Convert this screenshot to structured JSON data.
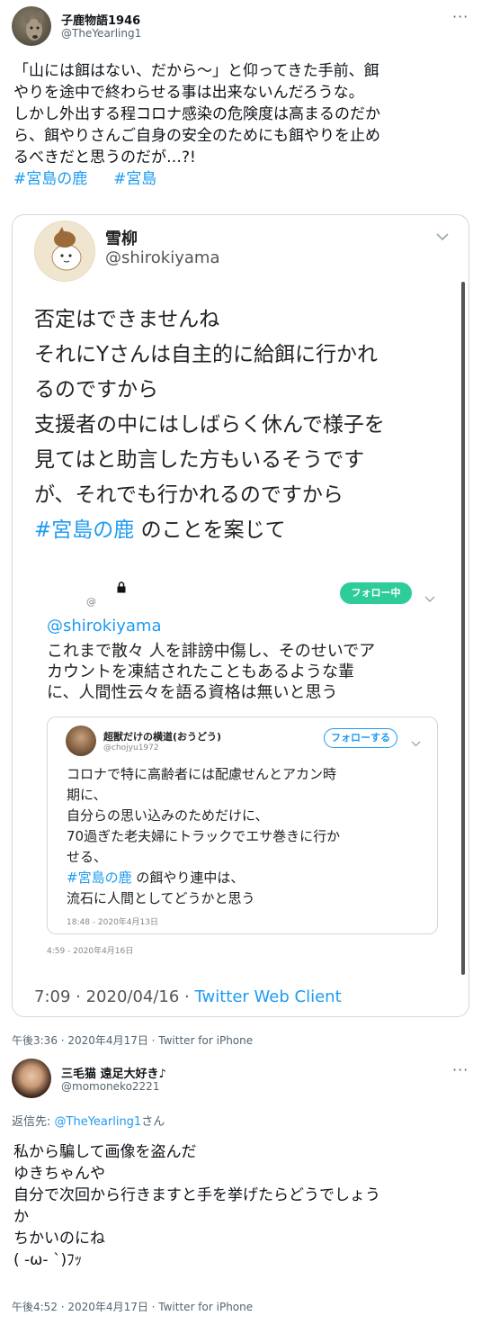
{
  "tweet1": {
    "name": "子鹿物語1946",
    "handle": "@TheYearling1",
    "more": "···",
    "lines": [
      "「山には餌はない、だから〜」と仰ってきた手前、餌",
      "やりを途中で終わらせる事は出来ないんだろうな。",
      "しかし外出する程コロナ感染の危険度は高まるのだか",
      "ら、餌やりさんご自身の安全のためにも餌やりを止め",
      "るべきだと思うのだが…?!"
    ],
    "hashtags": [
      "#宮島の鹿",
      "#宮島"
    ],
    "timestamp": "午後3:36 · 2020年4月17日 · Twitter for iPhone"
  },
  "screenshot": {
    "name": "雪柳",
    "handle": "@shirokiyama",
    "lines": [
      "否定はできませんね",
      "それにYさんは自主的に給餌に行かれ",
      "るのですから",
      "支援者の中にはしばらく休んで様子を",
      "見てはと助言した方もいるそうです",
      "が、それでも行かれるのですから"
    ],
    "last_line_hashtag": "#宮島の鹿",
    "last_line_rest": " のことを案じて",
    "reply": {
      "at_symbol": "@",
      "follow_label": "フォロー中",
      "mention": "@shirokiyama",
      "lines": [
        "これまで散々 人を誹謗中傷し、そのせいでア",
        "カウントを凍結されたこともあるような輩",
        "に、人間性云々を語る資格は無いと思う"
      ],
      "timestamp": "4:59 - 2020年4月16日"
    },
    "quote": {
      "name": "超獣だけの横道(おうどう)",
      "handle": "@chojyu1972",
      "follow_label": "フォローする",
      "lines": [
        "コロナで特に高齢者には配慮せんとアカン時",
        "期に、",
        "自分らの思い込みのためだけに、",
        "70過ぎた老夫婦にトラックでエサ巻きに行か",
        "せる、"
      ],
      "hashtag": "#宮島の鹿",
      "hashtag_rest": " の餌やり連中は、",
      "last_line": "流石に人間としてどうかと思う",
      "timestamp": "18:48 - 2020年4月13日"
    },
    "footer_time": "7:09 · 2020/04/16 · ",
    "footer_client": "Twitter Web Client"
  },
  "tweet2": {
    "name": "三毛猫 遠足大好き♪",
    "handle": "@momoneko2221",
    "more": "···",
    "reply_prefix": "返信先: ",
    "reply_to": "@TheYearling1",
    "reply_suffix": "さん",
    "lines": [
      "私から騙して画像を盗んだ",
      "ゆきちゃんや",
      "自分で次回から行きますと手を挙げたらどうでしょう",
      "か",
      "ちかいのにね",
      "( -ω- `)ﾌｯ"
    ],
    "timestamp": "午後4:52 · 2020年4月17日 · Twitter for iPhone"
  }
}
